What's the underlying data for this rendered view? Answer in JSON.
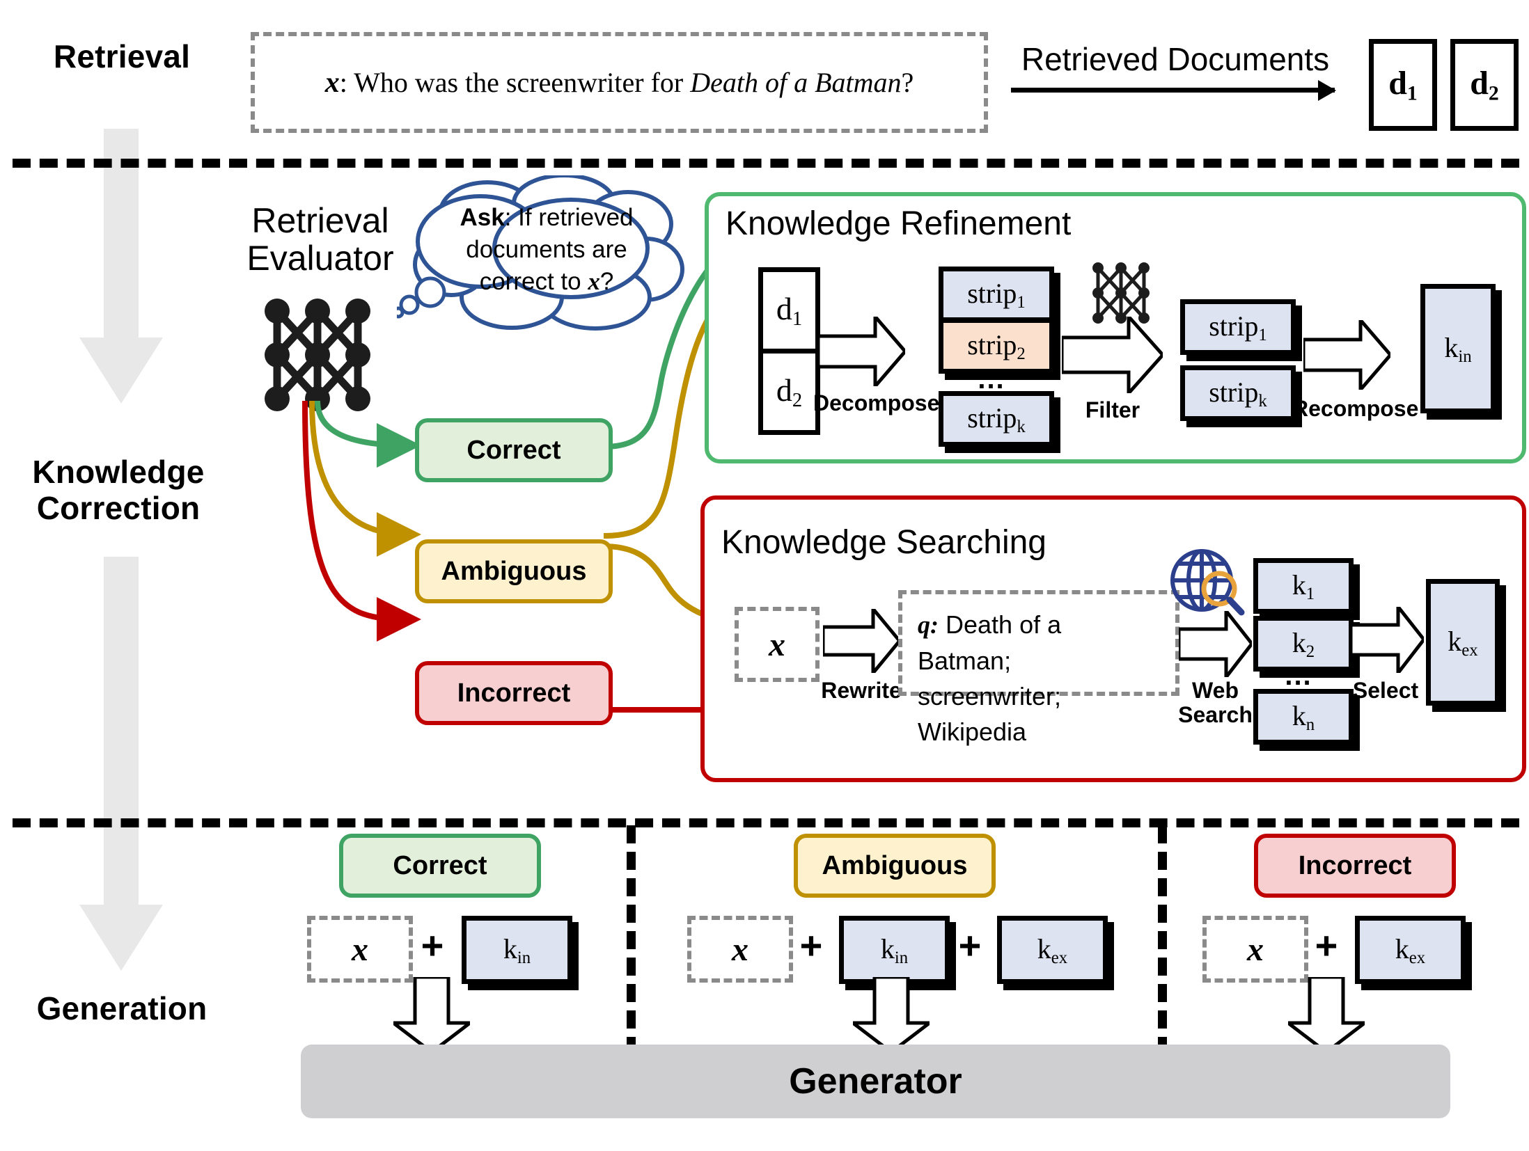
{
  "stages": {
    "retrieval": "Retrieval",
    "knowledge_correction_l1": "Knowledge",
    "knowledge_correction_l2": "Correction",
    "generation": "Generation"
  },
  "retrieval": {
    "query_prefix": "x",
    "query_colon": ": ",
    "query_text_a": "Who was the screenwriter for ",
    "query_text_italic": "Death of a Batman",
    "query_text_b": "?",
    "arrow_label": "Retrieved Documents",
    "documents": [
      {
        "base": "d",
        "sub": "1"
      },
      {
        "base": "d",
        "sub": "2"
      }
    ]
  },
  "evaluator": {
    "label_line1": "Retrieval",
    "label_line2": "Evaluator",
    "bubble": {
      "lead": "Ask",
      "line1_rest": ": If retrieved",
      "line2": "documents are",
      "line3_a": "correct to ",
      "line3_var": "x",
      "line3_b": "?"
    },
    "icon": "neural-network-icon"
  },
  "verdicts": {
    "correct": "Correct",
    "ambiguous": "Ambiguous",
    "incorrect": "Incorrect"
  },
  "colors": {
    "correct_border": "#3fa463",
    "correct_fill": "#e2efda",
    "ambiguous_border": "#bf9000",
    "ambiguous_fill": "#fdf2cd",
    "incorrect_border": "#c00000",
    "incorrect_fill": "#f8cfd0",
    "panel_green": "#4fb96f",
    "panel_red": "#c00000",
    "knowledge_fill": "#dde3f0",
    "highlight_fill": "#fbe0cd",
    "generator_fill": "#cfcfd2",
    "stage_arrow": "#e8e8e8",
    "globe": "#2b3f8c",
    "magnifier": "#e8a33d"
  },
  "refinement": {
    "title": "Knowledge Refinement",
    "docs": [
      {
        "base": "d",
        "sub": "1"
      },
      {
        "base": "d",
        "sub": "2"
      }
    ],
    "step_decompose": "Decompose",
    "strips_in": [
      {
        "base": "strip",
        "sub": "1",
        "highlight": false
      },
      {
        "base": "strip",
        "sub": "2",
        "highlight": true
      },
      {
        "base": "strip",
        "sub": "k",
        "highlight": false
      }
    ],
    "ellipsis": "...",
    "filter_icon": "neural-network-icon",
    "step_filter": "Filter",
    "strips_out": [
      {
        "base": "strip",
        "sub": "1"
      },
      {
        "base": "strip",
        "sub": "k"
      }
    ],
    "step_recompose": "Recompose",
    "output": {
      "base": "k",
      "sub": "in"
    }
  },
  "searching": {
    "title": "Knowledge Searching",
    "input_var": "x",
    "step_rewrite": "Rewrite",
    "query_prefix": "q:",
    "query_line1": " Death of a Batman;",
    "query_line2": "screenwriter; Wikipedia",
    "web_icon": "globe-search-icon",
    "step_web_l1": "Web",
    "step_web_l2": "Search",
    "results": [
      {
        "base": "k",
        "sub": "1"
      },
      {
        "base": "k",
        "sub": "2"
      },
      {
        "base": "k",
        "sub": "n"
      }
    ],
    "ellipsis": "...",
    "step_select": "Select",
    "output": {
      "base": "k",
      "sub": "ex"
    }
  },
  "generation": {
    "columns": [
      {
        "pill": "Correct",
        "pill_kind": "correct",
        "input_var": "x",
        "plus": "+",
        "items": [
          {
            "base": "k",
            "sub": "in"
          }
        ]
      },
      {
        "pill": "Ambiguous",
        "pill_kind": "ambiguous",
        "input_var": "x",
        "plus": "+",
        "items": [
          {
            "base": "k",
            "sub": "in"
          },
          {
            "base": "k",
            "sub": "ex"
          }
        ]
      },
      {
        "pill": "Incorrect",
        "pill_kind": "incorrect",
        "input_var": "x",
        "plus": "+",
        "items": [
          {
            "base": "k",
            "sub": "ex"
          }
        ]
      }
    ],
    "generator": "Generator"
  }
}
